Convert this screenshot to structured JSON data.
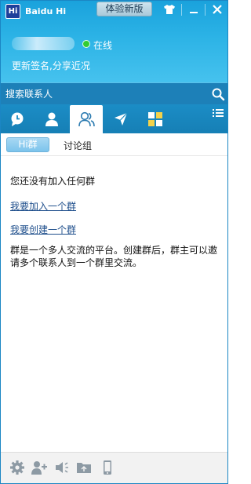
{
  "app": {
    "title": "Baidu Hi",
    "logo_text": "Hi",
    "trial_button": "体验新版"
  },
  "window_controls": {
    "skin_icon": "tshirt-icon",
    "minimize_label": "—",
    "close_label": "✕"
  },
  "profile": {
    "status": "在线",
    "status_color": "#33cc33",
    "signature": "更新签名,分享近况"
  },
  "search": {
    "placeholder": "搜索联系人",
    "icon": "search-icon"
  },
  "tabs": [
    {
      "name": "recent-chats",
      "icon": "chat-bubble-icon",
      "active": false
    },
    {
      "name": "contacts",
      "icon": "person-icon",
      "active": false
    },
    {
      "name": "groups",
      "icon": "group-icon",
      "active": true
    },
    {
      "name": "messages",
      "icon": "send-arrow-icon",
      "active": false
    },
    {
      "name": "apps",
      "icon": "apps-grid-icon",
      "active": false
    }
  ],
  "subtabs": {
    "hi_group": "Hi群",
    "discussion": "讨论组"
  },
  "content": {
    "no_group_text": "您还没有加入任何群",
    "join_link": "我要加入一个群",
    "create_link": "我要创建一个群",
    "description": "群是一个多人交流的平台。创建群后，群主可以邀请多个联系人到一个群里交流。"
  },
  "bottom_tools": [
    {
      "name": "settings",
      "icon": "gear-icon"
    },
    {
      "name": "add-contact",
      "icon": "add-person-icon"
    },
    {
      "name": "sound",
      "icon": "speaker-icon"
    },
    {
      "name": "files",
      "icon": "folder-icon"
    },
    {
      "name": "mobile",
      "icon": "mobile-phone-icon"
    }
  ],
  "colors": {
    "header": "#1aa2dc",
    "accent": "#1b86c4",
    "link": "#1f4f8c"
  }
}
